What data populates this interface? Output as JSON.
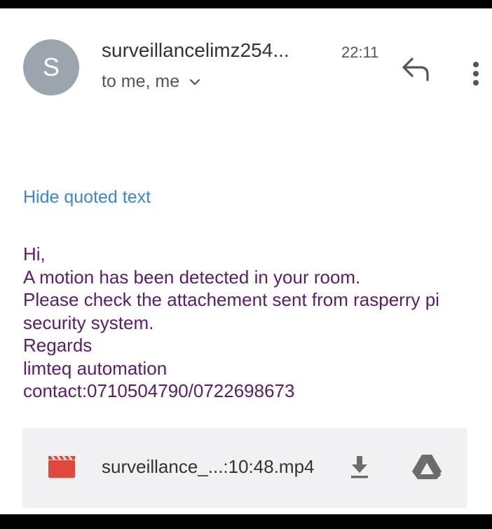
{
  "header": {
    "avatar_letter": "S",
    "sender": "surveillancelimz254...",
    "time": "22:11",
    "recipients": "to me, me",
    "reply_icon": "reply-icon",
    "more_icon": "more-vert-icon",
    "avatar_color": "#9aa5ae"
  },
  "hide_quoted_text": "Hide quoted text",
  "message": {
    "lines": [
      "Hi,",
      "A motion has been detected in your room.",
      "Please check the attachement sent from rasperry pi",
      "security system.",
      "Regards",
      "limteq automation",
      "contact:0710504790/0722698673"
    ],
    "text_color": "#5c1b6b"
  },
  "attachment": {
    "filename": "surveillance_...:10:48.mp4",
    "type_icon": "video-file-icon",
    "download_icon": "download-icon",
    "drive_icon": "google-drive-icon",
    "icon_color": "#e0483e"
  },
  "colors": {
    "link": "#3a86d6",
    "background": "#ffffff",
    "frame": "#000000"
  }
}
